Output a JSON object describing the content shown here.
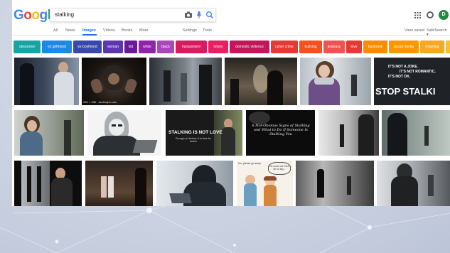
{
  "search": {
    "query": "stalking"
  },
  "logo": {
    "letters": [
      "G",
      "o",
      "o",
      "g",
      "l",
      "e"
    ],
    "colors": [
      "#4285f4",
      "#ea4335",
      "#fbbc05",
      "#4285f4",
      "#34a853",
      "#ea4335"
    ]
  },
  "nav": {
    "tabs": [
      "All",
      "News",
      "Images",
      "Videos",
      "Books",
      "More"
    ],
    "active": "Images",
    "tools": [
      "Settings",
      "Tools"
    ],
    "right": [
      "View saved",
      "SafeSearch ▾"
    ]
  },
  "user": {
    "initial": "D"
  },
  "chips": [
    {
      "label": "obsessive",
      "color": "#1aa3a3"
    },
    {
      "label": "ex girlfriend",
      "color": "#1e88e5"
    },
    {
      "label": "ex boyfriend",
      "color": "#3949ab"
    },
    {
      "label": "woman",
      "color": "#5e35b1"
    },
    {
      "label": "kid",
      "color": "#6a1b9a"
    },
    {
      "label": "white",
      "color": "#8e24aa"
    },
    {
      "label": "black",
      "color": "#ab47bc"
    },
    {
      "label": "harassment",
      "color": "#d81b60"
    },
    {
      "label": "felony",
      "color": "#e91e63"
    },
    {
      "label": "domestic violence",
      "color": "#c2185b"
    },
    {
      "label": "cyber crime",
      "color": "#e53935"
    },
    {
      "label": "bullying",
      "color": "#f4511e"
    },
    {
      "label": "jealousy",
      "color": "#ef5350"
    },
    {
      "label": "love",
      "color": "#e53935"
    },
    {
      "label": "facebook",
      "color": "#fb8c00"
    },
    {
      "label": "social media",
      "color": "#ff9800"
    },
    {
      "label": "meaning",
      "color": "#f9a825"
    }
  ],
  "images": {
    "thumb_label": "250 × 188 · asebcaps.com",
    "stop_lines": [
      "IT'S NOT A JOKE.",
      "IT'S NOT ROMANTIC,",
      "IT'S NOT OK."
    ],
    "stop_big": "STOP STALKI",
    "notlove_big": "STALKING IS NOT LOVE",
    "notlove_small": "Enough of rhetoric, it is time for action",
    "signs_text": "8 Not-Obvious Signs of Stalking and What to Do If Someone Is Stalking You",
    "cartoon_text": "Oh come on! Don't be so shy...",
    "cartoon_speech": "No, please go away"
  }
}
